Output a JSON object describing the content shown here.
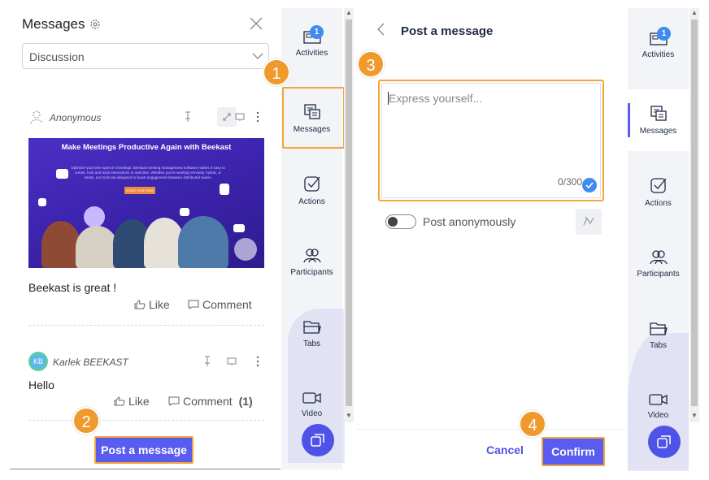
{
  "left": {
    "title": "Messages",
    "discussion_value": "Discussion",
    "posts": [
      {
        "author": "Anonymous",
        "image": {
          "title": "Make Meetings Productive Again with Beekast",
          "subtitle": "Optimize your time spent in meetings. Beekast meeting management software makes it easy to create, host and track interactions in real-time. Whether you're working remotely, hybrid, or onsite, our tools are designed to boost engagement between distributed teams.",
          "cta": "START FOR FREE"
        },
        "text": "Beekast is great !",
        "like_label": "Like",
        "comment_label": "Comment"
      },
      {
        "author": "Karlek BEEKAST",
        "avatar_initials": "KB",
        "text": "Hello",
        "like_label": "Like",
        "comment_label": "Comment",
        "comment_count": "(1)"
      }
    ],
    "post_button": "Post a message"
  },
  "sidebar": {
    "items": [
      {
        "label": "Activities",
        "icon": "activities-icon",
        "badge": "1"
      },
      {
        "label": "Messages",
        "icon": "messages-icon"
      },
      {
        "label": "Actions",
        "icon": "actions-icon"
      },
      {
        "label": "Participants",
        "icon": "participants-icon"
      },
      {
        "label": "Tabs",
        "icon": "folder-icon"
      },
      {
        "label": "Video",
        "icon": "video-icon"
      }
    ]
  },
  "right": {
    "title": "Post a message",
    "placeholder": "Express yourself...",
    "char_count": "0/300",
    "anonymous_label": "Post anonymously",
    "cancel": "Cancel",
    "confirm": "Confirm"
  },
  "steps": [
    "1",
    "2",
    "3",
    "4"
  ],
  "colors": {
    "accent": "#5a5cf0",
    "highlight": "#f2a53a",
    "step": "#f09a2e",
    "badge": "#3f8cf0"
  }
}
